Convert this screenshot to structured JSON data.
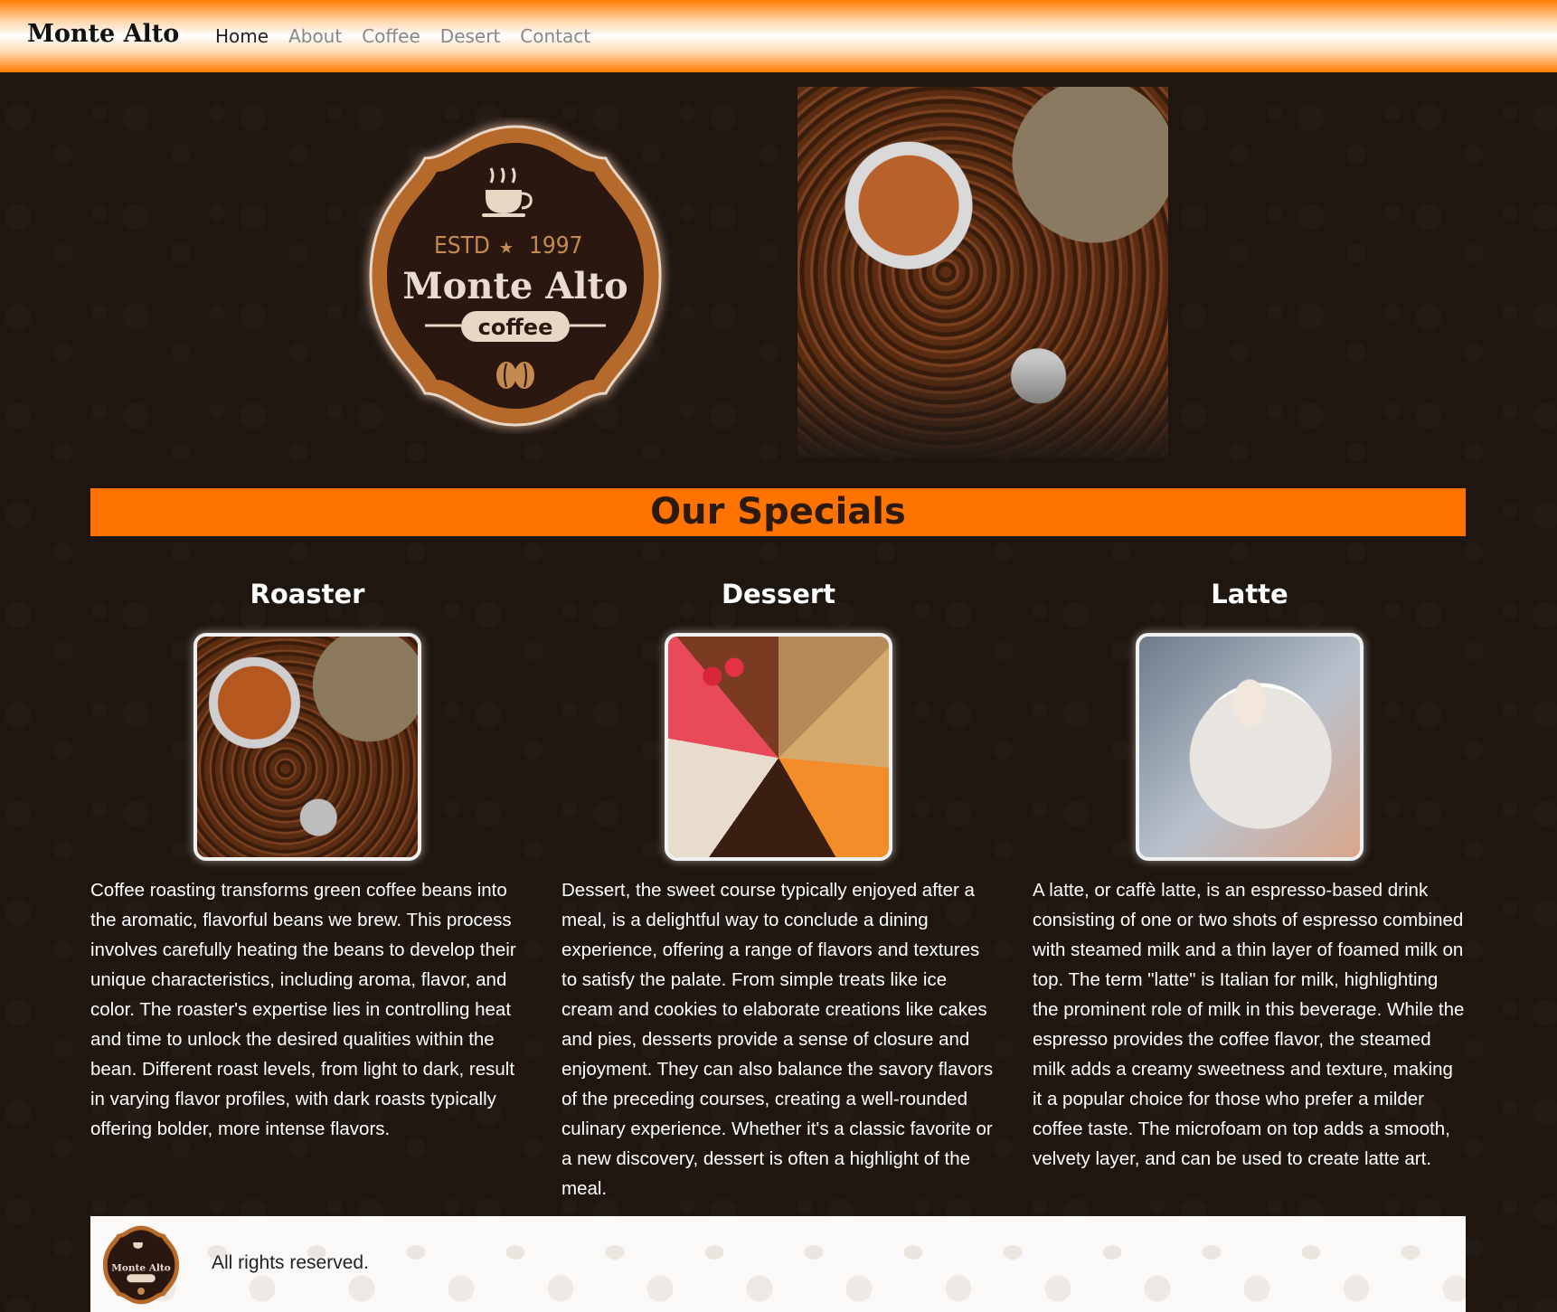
{
  "navbar": {
    "brand": "Monte Alto",
    "links": [
      {
        "label": "Home"
      },
      {
        "label": "About"
      },
      {
        "label": "Coffee"
      },
      {
        "label": "Desert"
      },
      {
        "label": "Contact"
      }
    ]
  },
  "hero": {
    "logo": {
      "estd": "ESTD",
      "year": "1997",
      "name": "Monte Alto",
      "tag": "coffee"
    }
  },
  "specials": {
    "title": "Our Specials",
    "cards": [
      {
        "title": "Roaster",
        "text": "Coffee roasting transforms green coffee beans into the aromatic, flavorful beans we brew. This process involves carefully heating the beans to develop their unique characteristics, including aroma, flavor, and color. The roaster's expertise lies in controlling heat and time to unlock the desired qualities within the bean. Different roast levels, from light to dark, result in varying flavor profiles, with dark roasts typically offering bolder, more intense flavors."
      },
      {
        "title": "Dessert",
        "text": "Dessert, the sweet course typically enjoyed after a meal, is a delightful way to conclude a dining experience, offering a range of flavors and textures to satisfy the palate. From simple treats like ice cream and cookies to elaborate creations like cakes and pies, desserts provide a sense of closure and enjoyment. They can also balance the savory flavors of the preceding courses, creating a well-rounded culinary experience. Whether it's a classic favorite or a new discovery, dessert is often a highlight of the meal."
      },
      {
        "title": "Latte",
        "text": "A latte, or caffè latte, is an espresso-based drink consisting of one or two shots of espresso combined with steamed milk and a thin layer of foamed milk on top. The term \"latte\" is Italian for milk, highlighting the prominent role of milk in this beverage. While the espresso provides the coffee flavor, the steamed milk adds a creamy sweetness and texture, making it a popular choice for those who prefer a milder coffee taste. The microfoam on top adds a smooth, velvety layer, and can be used to create latte art."
      }
    ]
  },
  "footer": {
    "text": "All rights reserved."
  },
  "colors": {
    "accent": "#ff7300",
    "background": "#1f1610",
    "logo_dark": "#2a1810",
    "logo_gold": "#b5692a"
  }
}
